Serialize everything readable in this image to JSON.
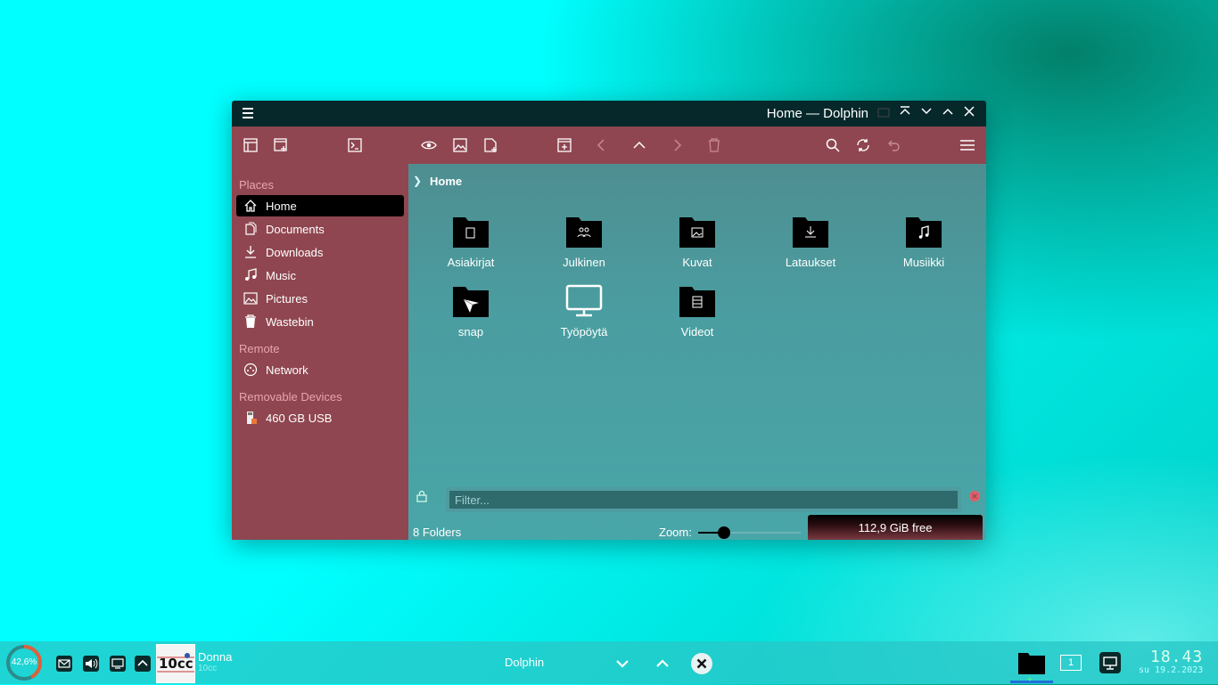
{
  "window": {
    "title": "Home — Dolphin",
    "controls": [
      "keep-above-icon",
      "shade-icon",
      "minimize-icon",
      "maximize-icon",
      "close-icon"
    ]
  },
  "toolbar": {
    "buttons": [
      "view-mode-icon",
      "new-window-icon",
      "terminal-icon",
      "preview-icon",
      "image-icon",
      "new-tab-icon",
      "split-view-icon",
      "back-icon",
      "up-icon",
      "forward-icon",
      "trash-icon",
      "search-icon",
      "reload-icon",
      "undo-icon",
      "hamburger-menu-icon"
    ]
  },
  "sidebar": {
    "sections": [
      {
        "title": "Places",
        "items": [
          {
            "label": "Home",
            "icon": "home-icon",
            "active": true
          },
          {
            "label": "Documents",
            "icon": "documents-icon"
          },
          {
            "label": "Downloads",
            "icon": "downloads-icon"
          },
          {
            "label": "Music",
            "icon": "music-icon"
          },
          {
            "label": "Pictures",
            "icon": "pictures-icon"
          },
          {
            "label": "Wastebin",
            "icon": "wastebin-icon"
          }
        ]
      },
      {
        "title": "Remote",
        "items": [
          {
            "label": "Network",
            "icon": "network-icon"
          }
        ]
      },
      {
        "title": "Removable Devices",
        "items": [
          {
            "label": "460 GB USB",
            "icon": "usb-drive-icon"
          }
        ]
      }
    ]
  },
  "breadcrumb": {
    "current": "Home"
  },
  "files": [
    {
      "name": "Asiakirjat",
      "icon": "documents-folder-icon"
    },
    {
      "name": "Julkinen",
      "icon": "public-folder-icon"
    },
    {
      "name": "Kuvat",
      "icon": "pictures-folder-icon"
    },
    {
      "name": "Lataukset",
      "icon": "downloads-folder-icon"
    },
    {
      "name": "Musiikki",
      "icon": "music-folder-icon"
    },
    {
      "name": "snap",
      "icon": "snap-folder-icon"
    },
    {
      "name": "Työpöytä",
      "icon": "desktop-icon"
    },
    {
      "name": "Videot",
      "icon": "videos-folder-icon"
    }
  ],
  "filter": {
    "placeholder": "Filter..."
  },
  "status": {
    "summary": "8 Folders",
    "zoom_label": "Zoom:",
    "zoom_level": 0.25,
    "free_space": "112,9 GiB free"
  },
  "taskbar": {
    "cpu_percent": "42,6%",
    "cpu_fraction": 0.426,
    "media_title": "Donna",
    "media_artist": "10cc",
    "task_title": "Dolphin",
    "pager_desktop": "1",
    "clock_time": "18.43",
    "clock_date": "su 19.2.2023"
  },
  "colors": {
    "titlebar": "#06282a",
    "toolbar_sidebar": "#8f4650",
    "content": "#4a9da0",
    "accent": "#00ffff"
  }
}
